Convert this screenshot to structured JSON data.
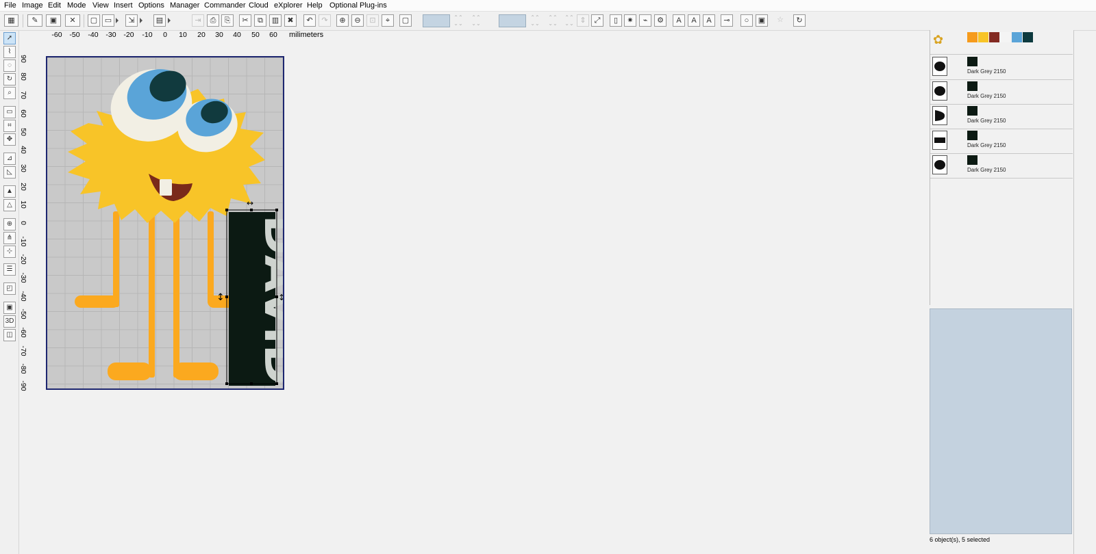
{
  "menu": [
    "File",
    "Image",
    "Edit",
    "Mode",
    "View",
    "Insert",
    "Options",
    "Manager",
    "Commander",
    "Cloud",
    "eXplorer",
    "Help",
    "Optional Plug-ins"
  ],
  "toolbar_icons": [
    "new-design",
    "open-design",
    "save-design",
    "undo",
    "redo",
    "zoom-in",
    "zoom-out",
    "select-all",
    "rotate",
    "mirror"
  ],
  "ruler": {
    "unit": "milimeters",
    "h_ticks": [
      "-60",
      "-50",
      "-40",
      "-30",
      "-20",
      "-10",
      "0",
      "10",
      "20",
      "30",
      "40",
      "50",
      "60"
    ],
    "v_ticks": [
      "90",
      "80",
      "70",
      "60",
      "50",
      "40",
      "30",
      "20",
      "10",
      "0",
      "-10",
      "-20",
      "-30",
      "-40",
      "-50",
      "-60",
      "-70",
      "-80",
      "-90"
    ]
  },
  "design": {
    "colors": {
      "body": "#f8c428",
      "legs": "#fba91f",
      "eye_white": "#f2efe4",
      "eye_blue": "#5aa4d8",
      "pupil": "#113a3e",
      "mouth": "#7a2a1a",
      "text": "#0c1a13",
      "hoop_border": "#1d2670"
    },
    "lettering_text": "DAVID"
  },
  "palette": {
    "colors": [
      "#f69b1c",
      "#f8c428",
      "#832a22",
      "#f4f4f4",
      "#5aa4d8",
      "#0d3a3f"
    ]
  },
  "objects": [
    {
      "label": "Dark Grey 2150"
    },
    {
      "label": "Dark Grey 2150"
    },
    {
      "label": "Dark Grey 2150"
    },
    {
      "label": "Dark Grey 2150"
    },
    {
      "label": "Dark Grey 2150"
    }
  ],
  "status": "6 object(s), 5 selected"
}
